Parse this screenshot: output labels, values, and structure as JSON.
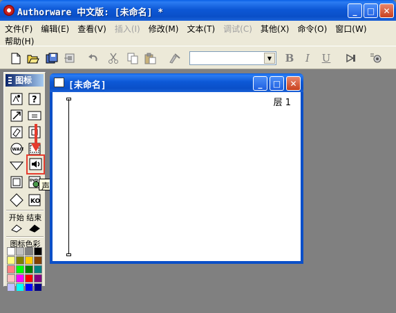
{
  "window": {
    "title": "Authorware 中文版: [未命名] *",
    "buttons": {
      "minimize": "_",
      "maximize": "□",
      "close": "✕"
    }
  },
  "menubar": {
    "row1": [
      {
        "label": "文件(F)",
        "enabled": true
      },
      {
        "label": "编辑(E)",
        "enabled": true
      },
      {
        "label": "查看(V)",
        "enabled": true
      },
      {
        "label": "插入(I)",
        "enabled": false
      },
      {
        "label": "修改(M)",
        "enabled": true
      },
      {
        "label": "文本(T)",
        "enabled": true
      },
      {
        "label": "调试(C)",
        "enabled": false
      },
      {
        "label": "其他(X)",
        "enabled": true
      },
      {
        "label": "命令(O)",
        "enabled": true
      },
      {
        "label": "窗口(W)",
        "enabled": true
      }
    ],
    "row2": [
      {
        "label": "帮助(H)",
        "enabled": true
      }
    ]
  },
  "toolbar": {
    "font_combo_value": "",
    "bold": "B",
    "italic": "I",
    "underline": "U",
    "icons": [
      "new-icon",
      "open-icon",
      "save-all-icon",
      "import-icon",
      "undo-icon",
      "cut-icon",
      "copy-icon",
      "paste-icon",
      "find-icon",
      "run-icon",
      "control-panel-icon"
    ]
  },
  "palette": {
    "title": "图标",
    "start_label": "开始",
    "end_label": "结束",
    "colors_label": "图标色彩",
    "tooltip": "声音",
    "icons": [
      "display-icon",
      "interaction-icon",
      "motion-icon",
      "calculation-icon",
      "erase-icon",
      "map-icon",
      "wait-icon",
      "digital-movie-icon",
      "navigate-icon",
      "sound-icon",
      "framework-icon",
      "dvd-icon",
      "decision-icon",
      "knowledge-object-icon"
    ],
    "swatches": [
      "#ffffff",
      "#c0c0c0",
      "#808080",
      "#000000",
      "#ffff80",
      "#808000",
      "#ffcc00",
      "#804000",
      "#ff8080",
      "#00ff00",
      "#008000",
      "#008080",
      "#ffc0c0",
      "#ff00ff",
      "#ff0000",
      "#800080",
      "#c0c0ff",
      "#00ffff",
      "#0000ff",
      "#000080"
    ]
  },
  "document": {
    "title": "[未命名]",
    "layer_label": "层 1"
  },
  "colors": {
    "accent_highlight": "#e53b2d",
    "title_bar_blue": "#0a4fc8",
    "chrome": "#ece9d8"
  }
}
